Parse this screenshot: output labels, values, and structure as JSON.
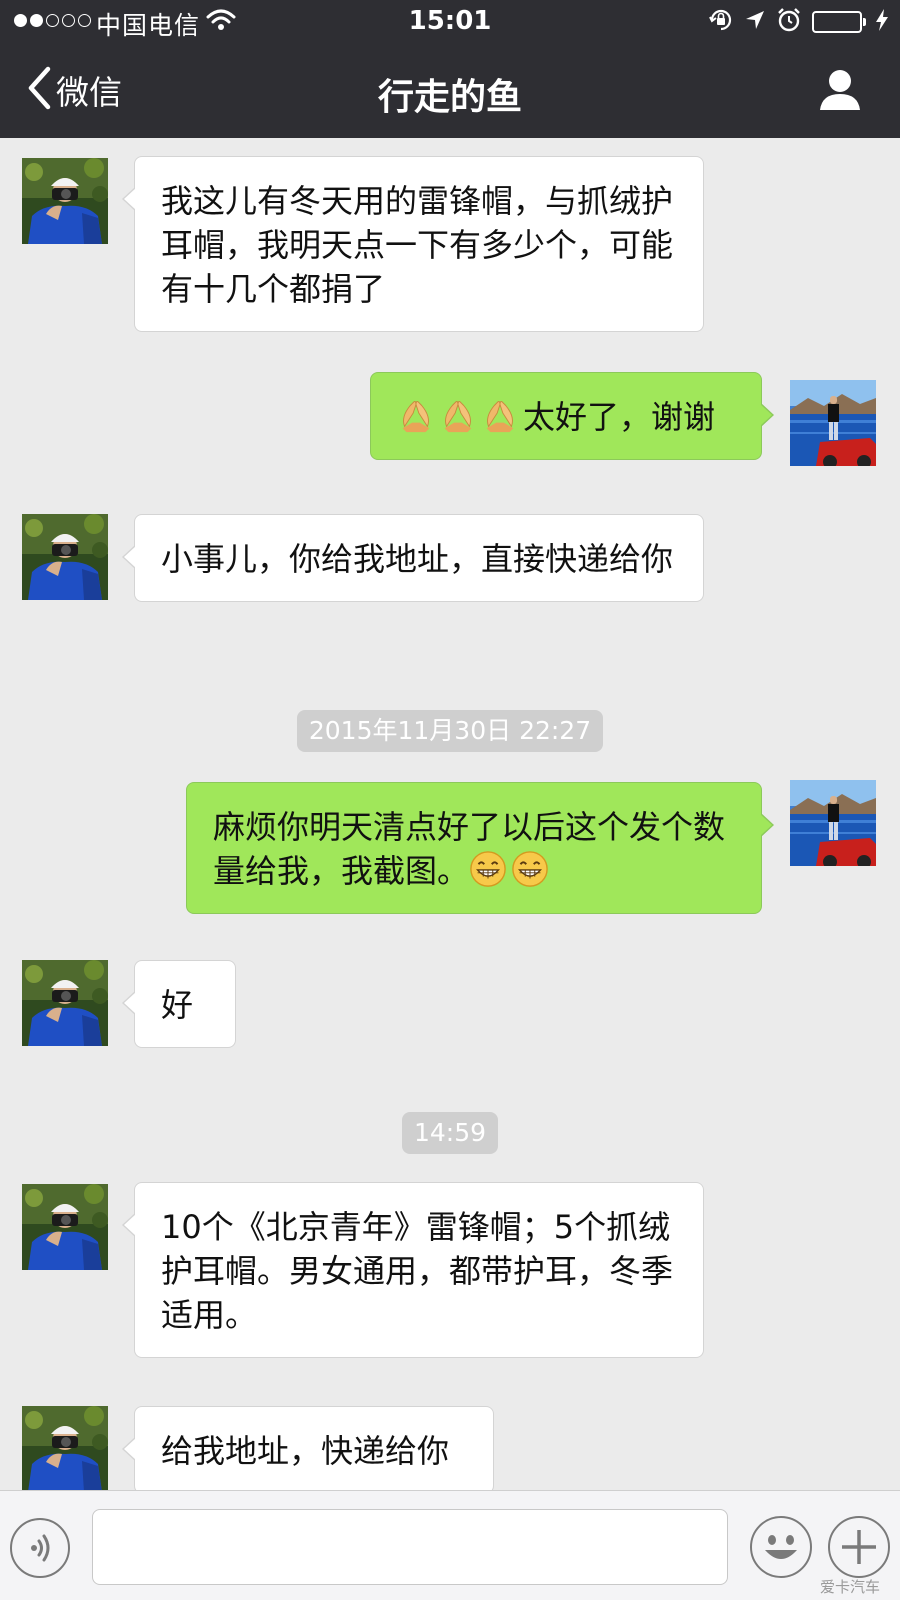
{
  "status_bar": {
    "carrier": "中国电信",
    "time": "15:01"
  },
  "nav": {
    "back_label": "微信",
    "title": "行走的鱼"
  },
  "messages": [
    {
      "type": "incoming",
      "text": "我这儿有冬天用的雷锋帽，与抓绒护耳帽，我明天点一下有多少个，可能有十几个都捐了"
    },
    {
      "type": "outgoing",
      "emoji": "praying-hands x3",
      "text": "太好了，谢谢"
    },
    {
      "type": "incoming",
      "text": "小事儿，你给我地址，直接快递给你"
    },
    {
      "type": "timestamp",
      "text": "2015年11月30日 22:27"
    },
    {
      "type": "outgoing",
      "text": "麻烦你明天清点好了以后这个发个数量给我，我截图。",
      "emoji": "grinning-face x2"
    },
    {
      "type": "incoming",
      "text": "好"
    },
    {
      "type": "timestamp",
      "text": "14:59"
    },
    {
      "type": "incoming",
      "text": "10个《北京青年》雷锋帽；5个抓绒护耳帽。男女通用，都带护耳，冬季适用。"
    },
    {
      "type": "incoming",
      "text": "给我地址，快递给你"
    }
  ],
  "input": {
    "value": "",
    "placeholder": ""
  },
  "watermark": "爱卡汽车",
  "colors": {
    "nav_background": "#2e2e33",
    "chat_background": "#ebebeb",
    "outgoing_bubble": "#a0e75a",
    "incoming_bubble": "#ffffff",
    "battery": "#4cd964"
  }
}
